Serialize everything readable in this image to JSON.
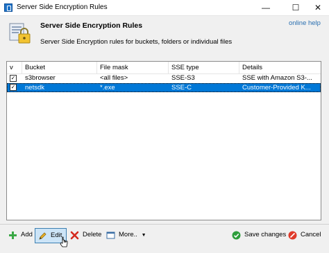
{
  "window": {
    "title": "Server Side Encryption Rules"
  },
  "header": {
    "title": "Server Side Encryption Rules",
    "description": "Server Side Encryption rules for buckets, folders or individual files",
    "help_link": "online help"
  },
  "table": {
    "columns": [
      "v",
      "Bucket",
      "File mask",
      "SSE type",
      "Details"
    ],
    "rows": [
      {
        "checked": true,
        "bucket": "s3browser",
        "file_mask": "<all files>",
        "sse_type": "SSE-S3",
        "details": "SSE with Amazon S3-..."
      },
      {
        "checked": true,
        "bucket": "netsdk",
        "file_mask": "*.exe",
        "sse_type": "SSE-C",
        "details": "Customer-Provided K..."
      }
    ]
  },
  "toolbar": {
    "add": "Add",
    "edit": "Edit",
    "delete": "Delete",
    "more": "More..",
    "save": "Save changes",
    "cancel": "Cancel"
  },
  "colors": {
    "selection": "#0078d7",
    "link": "#2a6fb0"
  }
}
